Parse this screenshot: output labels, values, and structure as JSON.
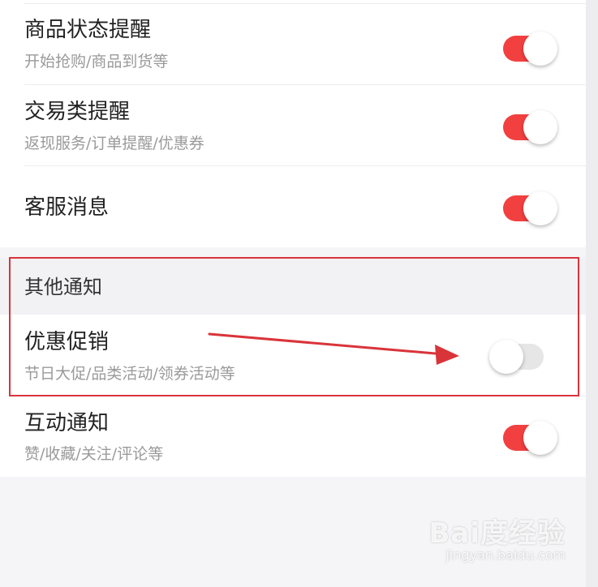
{
  "settings": [
    {
      "title": "商品状态提醒",
      "subtitle": "开始抢购/商品到货等",
      "enabled": true
    },
    {
      "title": "交易类提醒",
      "subtitle": "返现服务/订单提醒/优惠券",
      "enabled": true
    },
    {
      "title": "客服消息",
      "subtitle": "",
      "enabled": true
    }
  ],
  "other_section": {
    "header": "其他通知",
    "items": [
      {
        "title": "优惠促销",
        "subtitle": "节日大促/品类活动/领券活动等",
        "enabled": false
      },
      {
        "title": "互动通知",
        "subtitle": "赞/收藏/关注/评论等",
        "enabled": true
      }
    ]
  },
  "colors": {
    "toggle_on": "#f24040",
    "toggle_off": "#e6e6e6",
    "annotation": "#d9343a"
  },
  "watermark": {
    "main": "Bai度经验",
    "sub": "jingyan.baidu.com"
  }
}
